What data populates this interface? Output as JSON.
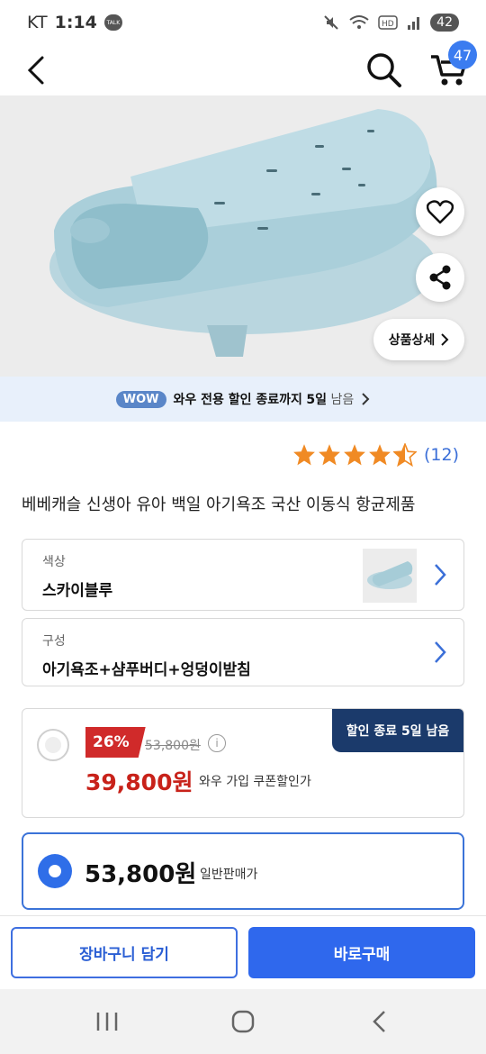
{
  "status": {
    "carrier": "KT",
    "time": "1:14",
    "talk": "TALK",
    "battery": "42"
  },
  "header": {
    "cart_count": "47"
  },
  "hero": {
    "detail_label": "상품상세"
  },
  "wow_bar": {
    "badge": "WOW",
    "text": "와우 전용 할인 종료까지",
    "days": "5일",
    "suffix": "남음"
  },
  "rating": {
    "stars": 4.5,
    "count": "(12)"
  },
  "product": {
    "title": "베베캐슬 신생아 유아 백일 아기욕조 국산 이동식 항균제품"
  },
  "options": [
    {
      "label": "색상",
      "value": "스카이블루"
    },
    {
      "label": "구성",
      "value": "아기욕조+샴푸버디+엉덩이받침"
    }
  ],
  "wow_price": {
    "ribbon": "할인 종료 5일 남음",
    "discount": "26%",
    "original": "53,800원",
    "sale": "39,800원",
    "note": "와우 가입 쿠폰할인가"
  },
  "normal_price": {
    "price": "53,800원",
    "label": "일반판매가"
  },
  "buttons": {
    "cart": "장바구니 담기",
    "buy": "바로구매"
  }
}
